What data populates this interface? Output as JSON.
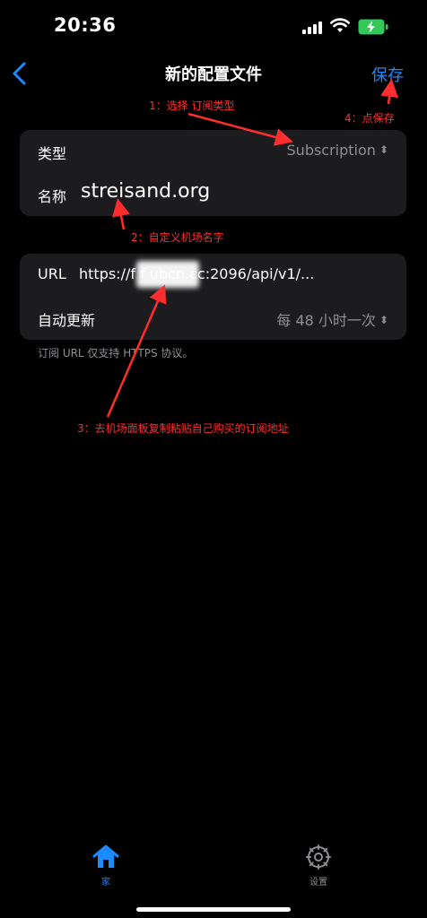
{
  "status_bar": {
    "time": "20:36"
  },
  "nav": {
    "title": "新的配置文件",
    "save_label": "保存"
  },
  "sections": {
    "profile": {
      "type_label": "类型",
      "type_value": "Subscription",
      "name_label": "名称",
      "name_value": "streisand.org"
    },
    "subscription": {
      "url_label": "URL",
      "url_value": "https://f            f        ubcn.cc:2096/api/v1/...",
      "update_label": "自动更新",
      "update_value": "每 48 小时一次"
    },
    "footer_note": "订阅 URL 仅支持 HTTPS 协议。"
  },
  "annotations": {
    "step1": "1：选择 订阅类型",
    "step2": "2：自定义机场名字",
    "step3": "3：去机场面板复制粘贴自己购买的订阅地址",
    "step4": "4：点保存"
  },
  "tab_bar": {
    "home_label": "家",
    "settings_label": "设置"
  },
  "colors": {
    "accent": "#1a8cff",
    "annotation": "#ff2d2d",
    "card_bg": "#1c1c1e",
    "secondary_text": "#8e8e93"
  },
  "icons": {
    "back": "chevron-left-icon",
    "home": "house-icon",
    "settings": "gear-icon",
    "signal": "cellular-signal-icon",
    "wifi": "wifi-icon",
    "battery": "battery-charging-icon"
  }
}
